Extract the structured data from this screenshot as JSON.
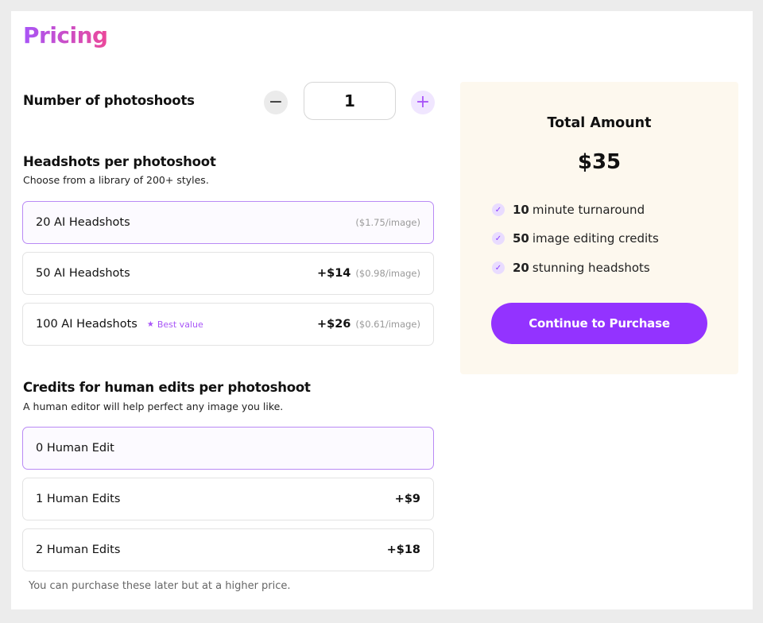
{
  "page": {
    "title": "Pricing"
  },
  "photoshoots": {
    "label": "Number of photoshoots",
    "minus_symbol": "−",
    "plus_symbol": "+",
    "quantity": "1"
  },
  "headshots": {
    "title": "Headshots per photoshoot",
    "subtitle": "Choose from a library of 200+ styles.",
    "options": [
      {
        "label": "20 AI Headshots",
        "price": "",
        "per_image": "($1.75/image)",
        "badge": "",
        "selected": true
      },
      {
        "label": "50 AI Headshots",
        "price": "+$14",
        "per_image": "($0.98/image)",
        "badge": "",
        "selected": false
      },
      {
        "label": "100 AI Headshots",
        "price": "+$26",
        "per_image": "($0.61/image)",
        "badge": "Best value",
        "badge_icon": "★",
        "selected": false
      }
    ]
  },
  "edits": {
    "title": "Credits for human edits per photoshoot",
    "subtitle": "A human editor will help perfect any image you like.",
    "options": [
      {
        "label": "0 Human Edit",
        "price": "",
        "selected": true
      },
      {
        "label": "1 Human Edits",
        "price": "+$9",
        "selected": false
      },
      {
        "label": "2 Human Edits",
        "price": "+$18",
        "selected": false
      }
    ],
    "footnote": "You can purchase these later but at a higher price."
  },
  "summary": {
    "title": "Total Amount",
    "amount": "$35",
    "check_glyph": "✓",
    "features": [
      {
        "bold": "10",
        "text": "minute turnaround"
      },
      {
        "bold": "50",
        "text": "image editing credits"
      },
      {
        "bold": "20",
        "text": "stunning headshots"
      }
    ],
    "cta_label": "Continue to Purchase"
  },
  "colors": {
    "accent": "#9333ff",
    "title_gradient_start": "#a855f7",
    "title_gradient_end": "#ec4899",
    "summary_bg": "#fdf8ee"
  }
}
